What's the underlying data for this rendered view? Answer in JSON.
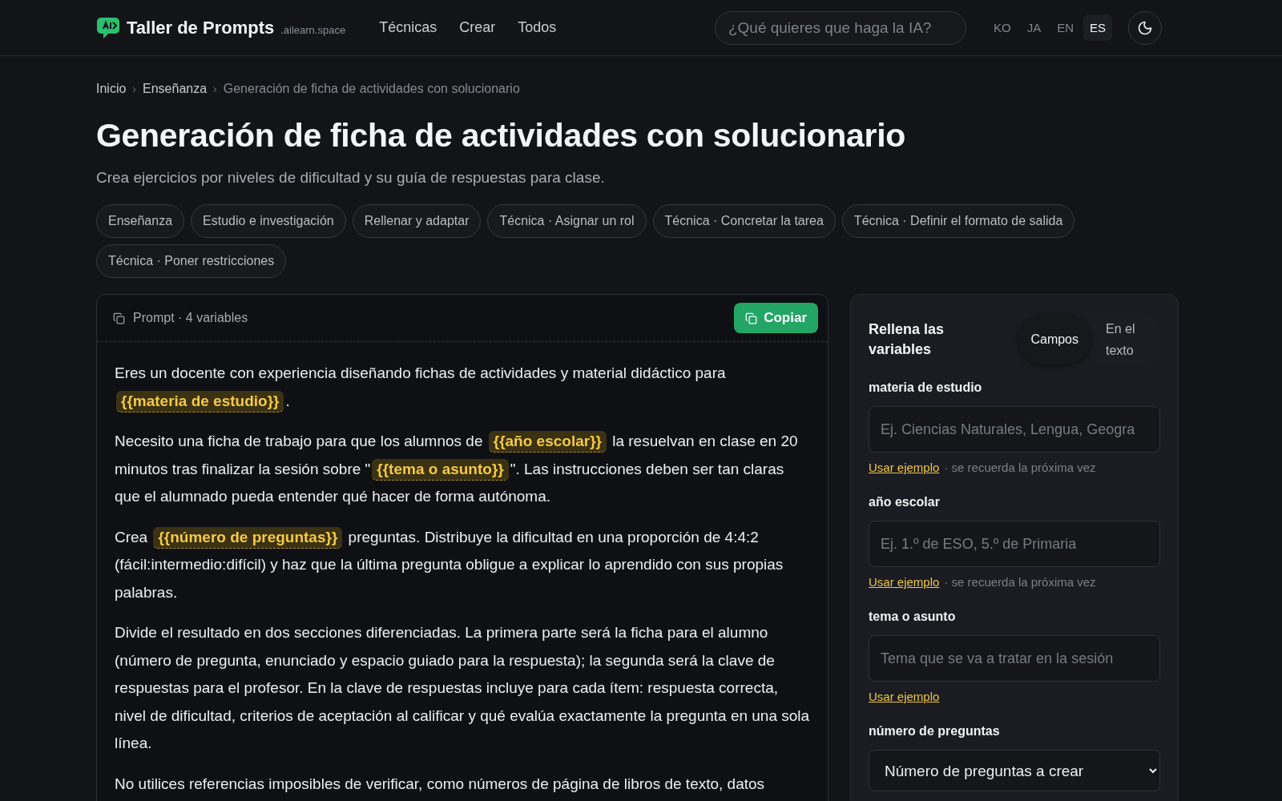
{
  "header": {
    "brand": "Taller de Prompts",
    "domain": ".ailearn.space",
    "nav": [
      "Técnicas",
      "Crear",
      "Todos"
    ],
    "search": {
      "placeholder": "¿Qué quieres que haga la IA?"
    },
    "languages": [
      {
        "label": "KO",
        "selected": false
      },
      {
        "label": "JA",
        "selected": false
      },
      {
        "label": "EN",
        "selected": false
      },
      {
        "label": "ES",
        "selected": true
      }
    ]
  },
  "breadcrumb": {
    "separator": "›",
    "items": [
      "Inicio",
      "Enseñanza",
      "Generación de ficha de actividades con solucionario"
    ]
  },
  "title": "Generación de ficha de actividades con solucionario",
  "subtitle": "Crea ejercicios por niveles de dificultad y su guía de respuestas para clase.",
  "tags": [
    "Enseñanza",
    "Estudio e investigación",
    "Rellenar y adaptar",
    "Técnica · Asignar un rol",
    "Técnica · Concretar la tarea",
    "Técnica · Definir el formato de salida",
    "Técnica · Poner restricciones"
  ],
  "prompt": {
    "label": "Prompt · 4 variables",
    "copy_button": "Copiar",
    "paragraphs": [
      {
        "segments": [
          {
            "kind": "text",
            "text": "Eres un docente con experiencia diseñando fichas de actividades y material didáctico para "
          },
          {
            "kind": "variable",
            "text": "{{materia de estudio}}"
          },
          {
            "kind": "text",
            "text": "."
          }
        ]
      },
      {
        "segments": [
          {
            "kind": "text",
            "text": "Necesito una ficha de trabajo para que los alumnos de "
          },
          {
            "kind": "variable",
            "text": "{{año escolar}}"
          },
          {
            "kind": "text",
            "text": " la resuelvan en clase en 20 minutos tras finalizar la sesión sobre \""
          },
          {
            "kind": "variable",
            "text": "{{tema o asunto}}"
          },
          {
            "kind": "text",
            "text": "\". Las instrucciones deben ser tan claras que el alumnado pueda entender qué hacer de forma autónoma."
          }
        ]
      },
      {
        "segments": [
          {
            "kind": "text",
            "text": "Crea "
          },
          {
            "kind": "variable",
            "text": "{{número de preguntas}}"
          },
          {
            "kind": "text",
            "text": " preguntas. Distribuye la dificultad en una proporción de 4:4:2 (fácil:intermedio:difícil) y haz que la última pregunta obligue a explicar lo aprendido con sus propias palabras."
          }
        ]
      },
      {
        "segments": [
          {
            "kind": "text",
            "text": "Divide el resultado en dos secciones diferenciadas. La primera parte será la ficha para el alumno (número de pregunta, enunciado y espacio guiado para la respuesta); la segunda será la clave de respuestas para el profesor. En la clave de respuestas incluye para cada ítem: respuesta correcta, nivel de dificultad, criterios de aceptación al calificar y qué evalúa exactamente la pregunta en una sola línea."
          }
        ]
      },
      {
        "segments": [
          {
            "kind": "text",
            "text": "No utilices referencias imposibles de verificar, como números de página de libros de texto, datos"
          }
        ]
      }
    ]
  },
  "variables_panel": {
    "title": "Rellena las variables",
    "modes": [
      {
        "label": "Campos",
        "selected": true
      },
      {
        "label": "En el texto",
        "selected": false
      }
    ],
    "fields": [
      {
        "kind": "input",
        "label": "materia de estudio",
        "placeholder": "Ej. Ciencias Naturales, Lengua, Geogra",
        "example_link": "Usar ejemplo",
        "note": "· se recuerda la próxima vez"
      },
      {
        "kind": "input",
        "label": "año escolar",
        "placeholder": "Ej. 1.º de ESO, 5.º de Primaria",
        "example_link": "Usar ejemplo",
        "note": "· se recuerda la próxima vez"
      },
      {
        "kind": "input",
        "label": "tema o asunto",
        "placeholder": "Tema que se va a tratar en la sesión",
        "example_link": "Usar ejemplo"
      },
      {
        "kind": "select",
        "label": "número de preguntas",
        "value": "Número de preguntas a crear"
      }
    ]
  }
}
